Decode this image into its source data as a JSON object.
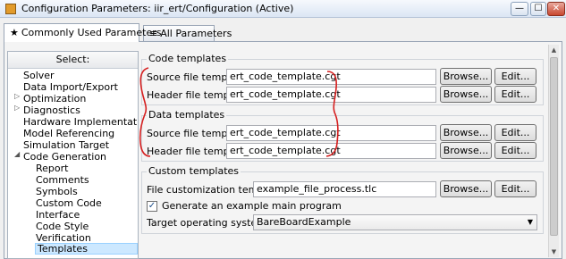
{
  "window": {
    "title": "Configuration Parameters: iir_ert/Configuration (Active)",
    "minimize": "—",
    "maximize": "☐",
    "close": "✕"
  },
  "tabs": [
    {
      "label": "Commonly Used Parameters",
      "icon": "★"
    },
    {
      "label": "All Parameters",
      "icon": "≡"
    }
  ],
  "tree": {
    "header": "Select:",
    "items": [
      "Solver",
      "Data Import/Export",
      "Optimization",
      "Diagnostics",
      "Hardware Implementation",
      "Model Referencing",
      "Simulation Target",
      "Code Generation",
      "Report",
      "Comments",
      "Symbols",
      "Custom Code",
      "Interface",
      "Code Style",
      "Verification",
      "Templates"
    ],
    "expand_collapsed": "▷",
    "expand_open": "◢",
    "selected": "Templates"
  },
  "code_templates": {
    "title": "Code templates",
    "source_label": "Source file template:",
    "source_value": "ert_code_template.cgt",
    "header_label": "Header file template:",
    "header_value": "ert_code_template.cgt"
  },
  "data_templates": {
    "title": "Data templates",
    "source_label": "Source file template:",
    "source_value": "ert_code_template.cgt",
    "header_label": "Header file template:",
    "header_value": "ert_code_template.cgt"
  },
  "custom_templates": {
    "title": "Custom templates",
    "file_label": "File customization template:",
    "file_value": "example_file_process.tlc",
    "generate_label": "Generate an example main program",
    "generate_checked": "✓",
    "os_label": "Target operating system:",
    "os_value": "BareBoardExample",
    "os_arrow": "▼"
  },
  "buttons": {
    "browse": "Browse...",
    "edit": "Edit..."
  },
  "scrollbar": {
    "up": "▲",
    "down": "▼"
  },
  "annotation_color": "#d62020"
}
